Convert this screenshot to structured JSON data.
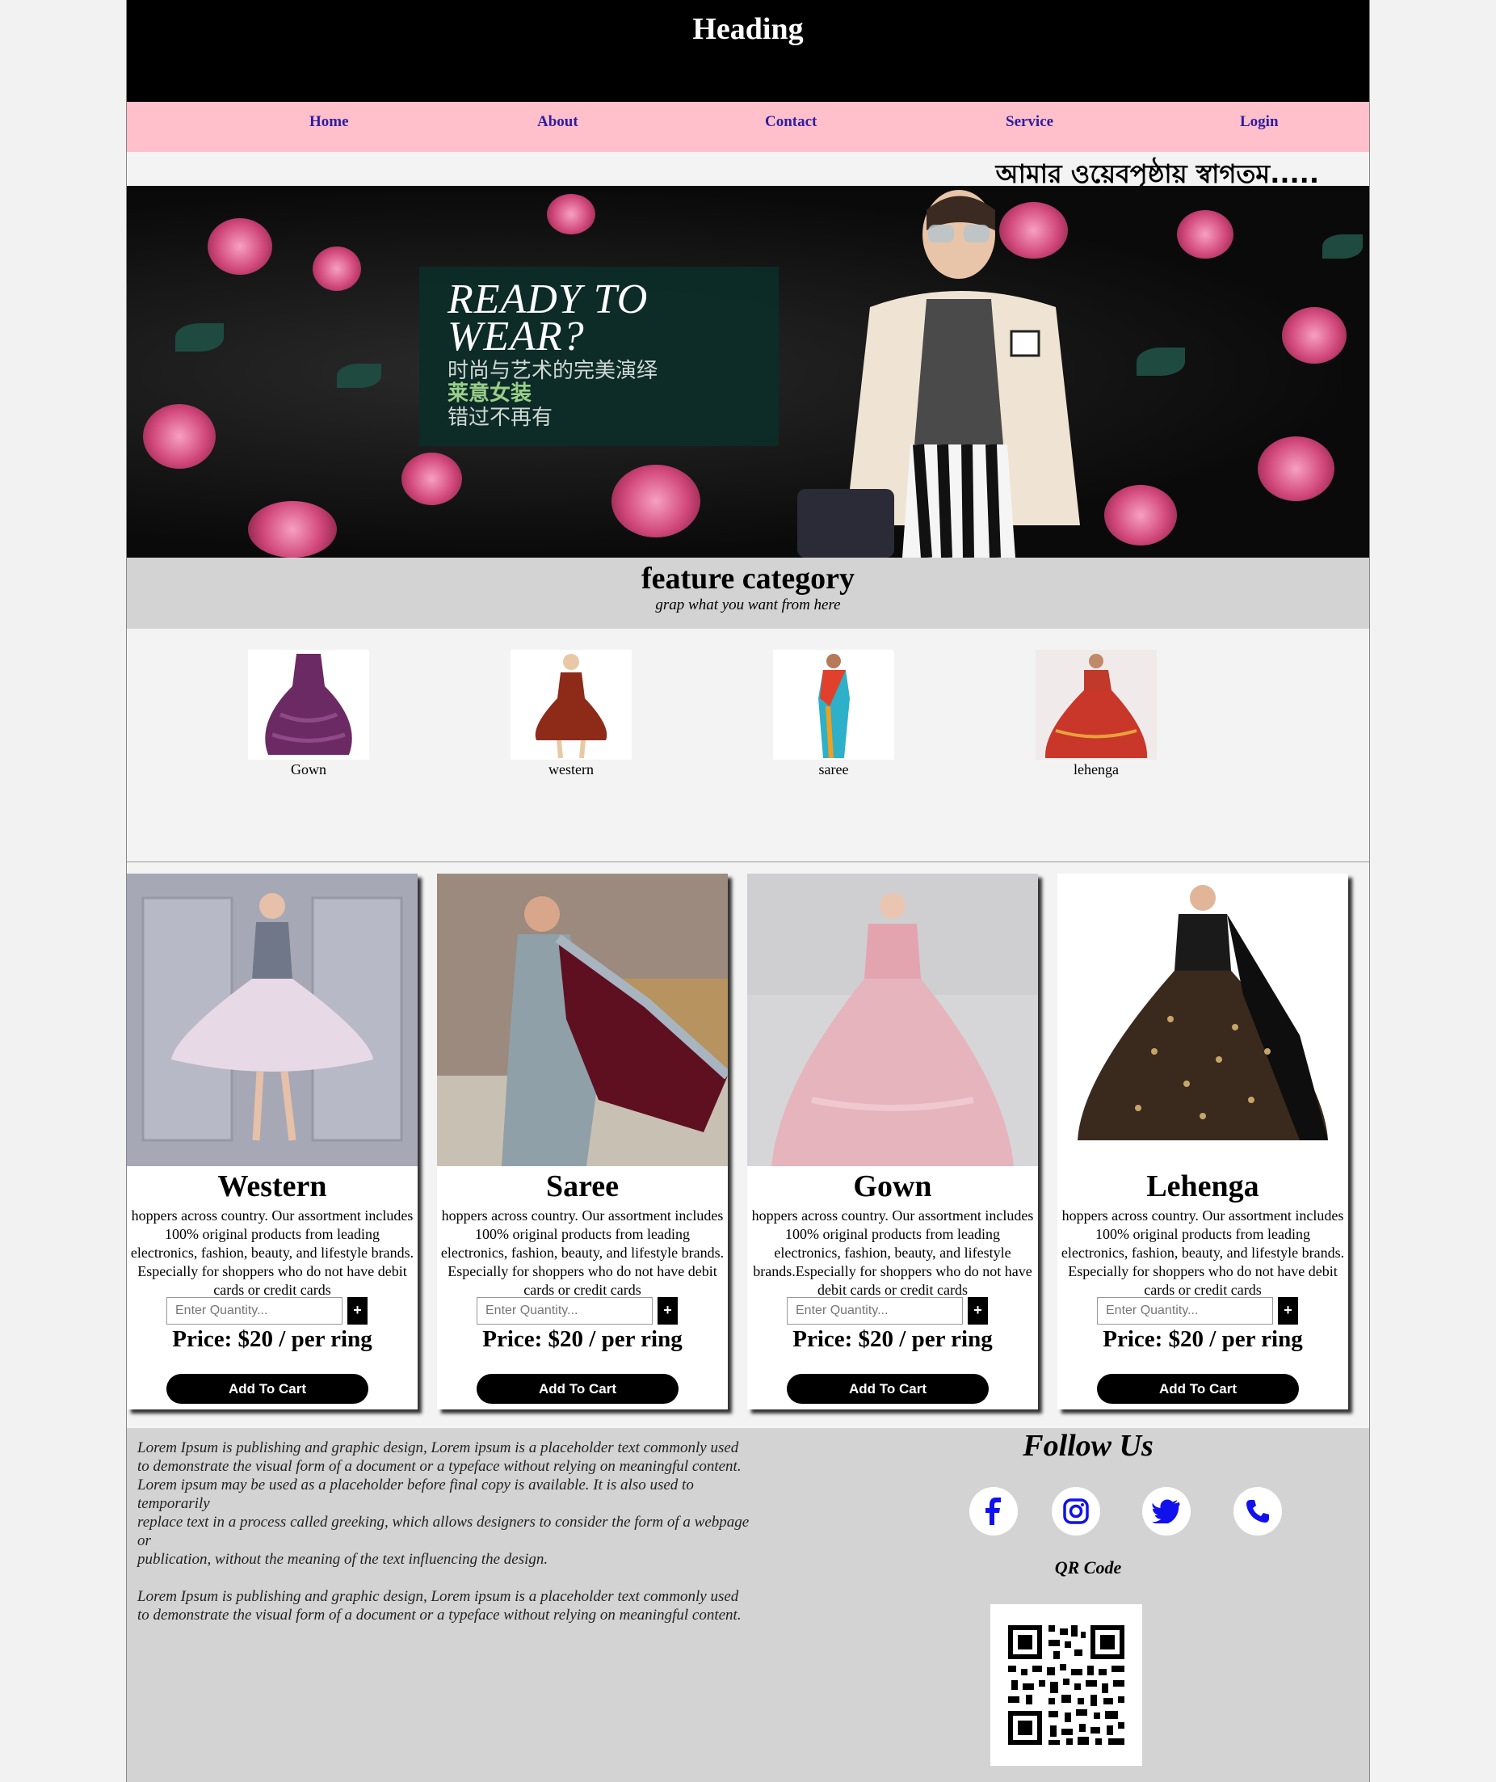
{
  "header": {
    "title": "Heading"
  },
  "nav": {
    "items": [
      "Home",
      "About",
      "Contact",
      "Service",
      "Login"
    ]
  },
  "marquee": {
    "text": "আমার ওয়েবপৃষ্ঠায় স্বাগতম....."
  },
  "banner": {
    "line1": "READY TO",
    "line2": "WEAR?",
    "line3": "时尚与艺术的完美演绎",
    "line4": "莱意女装",
    "line5": "错过不再有"
  },
  "feature": {
    "title": "feature category",
    "subtitle": "grap what you want from here"
  },
  "categories": [
    {
      "label": "Gown"
    },
    {
      "label": "western"
    },
    {
      "label": "saree"
    },
    {
      "label": "lehenga"
    }
  ],
  "products": [
    {
      "title": "Western",
      "desc": "hoppers across country. Our assortment includes 100% original products from leading electronics, fashion, beauty, and lifestyle brands. Especially for shoppers who do not have debit cards or credit cards",
      "qty_placeholder": "Enter Quantity...",
      "plus": "+",
      "price": "Price: $20 / per ring",
      "button": "Add To Cart"
    },
    {
      "title": "Saree",
      "desc": "hoppers across country. Our assortment includes 100% original products from leading electronics, fashion, beauty, and lifestyle brands. Especially for shoppers who do not have debit cards or credit cards",
      "qty_placeholder": "Enter Quantity...",
      "plus": "+",
      "price": "Price: $20 / per ring",
      "button": "Add To Cart"
    },
    {
      "title": "Gown",
      "desc": "hoppers across country. Our assortment includes 100% original products from leading electronics, fashion, beauty, and lifestyle brands.Especially for shoppers who do not have debit cards or credit cards",
      "qty_placeholder": "Enter Quantity...",
      "plus": "+",
      "price": "Price: $20 / per ring",
      "button": "Add To Cart"
    },
    {
      "title": "Lehenga",
      "desc": "hoppers across country. Our assortment includes 100% original products from leading electronics, fashion, beauty, and lifestyle brands. Especially for shoppers who do not have debit cards or credit cards",
      "qty_placeholder": "Enter Quantity...",
      "plus": "+",
      "price": "Price: $20 / per ring",
      "button": "Add To Cart"
    }
  ],
  "footer": {
    "lorem1": "Lorem Ipsum is publishing and graphic design, Lorem ipsum is a placeholder text commonly used\nto demonstrate the visual form of a document or a typeface without relying on meaningful content.\nLorem ipsum may be used as a placeholder before final copy is available. It is also used to temporarily\nreplace text in a process called greeking, which allows designers to consider the form of a webpage or\npublication, without the meaning of the text influencing the design.",
    "lorem2": "Lorem Ipsum is publishing and graphic design, Lorem ipsum is a placeholder text commonly used to demonstrate the visual form of a document or a typeface without relying on meaningful content.",
    "follow": "Follow Us",
    "social": [
      "facebook-icon",
      "instagram-icon",
      "twitter-icon",
      "phone-icon"
    ],
    "qr_label": "QR Code"
  },
  "colors": {
    "nav_bg": "#ffc0cb",
    "nav_link": "#2f1d9e",
    "social_icon": "#1111ee",
    "footer_bg": "#d3d3d3"
  }
}
